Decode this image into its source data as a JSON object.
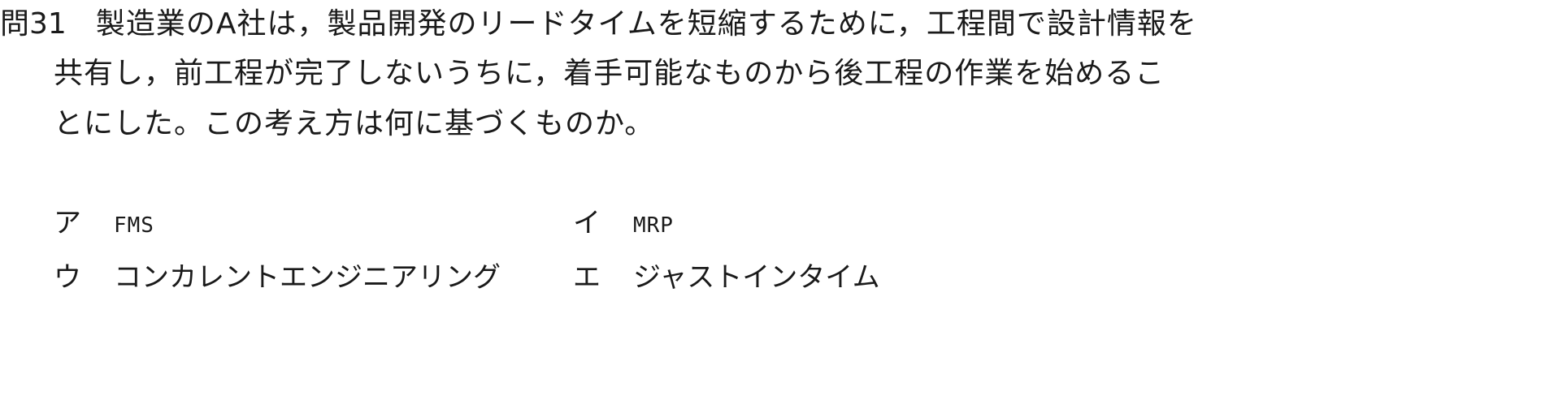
{
  "question": {
    "number": "問31",
    "lines": [
      "製造業のA社は，製品開発のリードタイムを短縮するために，工程間で設計情報を",
      "共有し，前工程が完了しないうちに，着手可能なものから後工程の作業を始めるこ",
      "とにした。この考え方は何に基づくものか。"
    ]
  },
  "choices": [
    {
      "label": "ア",
      "text": "FMS"
    },
    {
      "label": "イ",
      "text": "MRP"
    },
    {
      "label": "ウ",
      "text": "コンカレントエンジニアリング"
    },
    {
      "label": "エ",
      "text": "ジャストインタイム"
    }
  ]
}
